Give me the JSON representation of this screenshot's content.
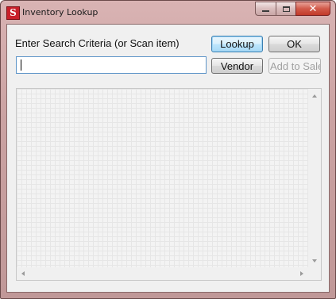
{
  "window": {
    "title": "Inventory Lookup",
    "icon_letter": "S",
    "icon_name": "app-s-icon",
    "accent_color": "#c9202a",
    "close_glyph": "✕"
  },
  "search": {
    "label": "Enter Search Criteria (or Scan item)",
    "value": "",
    "placeholder": ""
  },
  "buttons": {
    "lookup": "Lookup",
    "ok": "OK",
    "vendor": "Vendor",
    "add_to_sale": "Add to Sale"
  },
  "results": {
    "rows": []
  }
}
